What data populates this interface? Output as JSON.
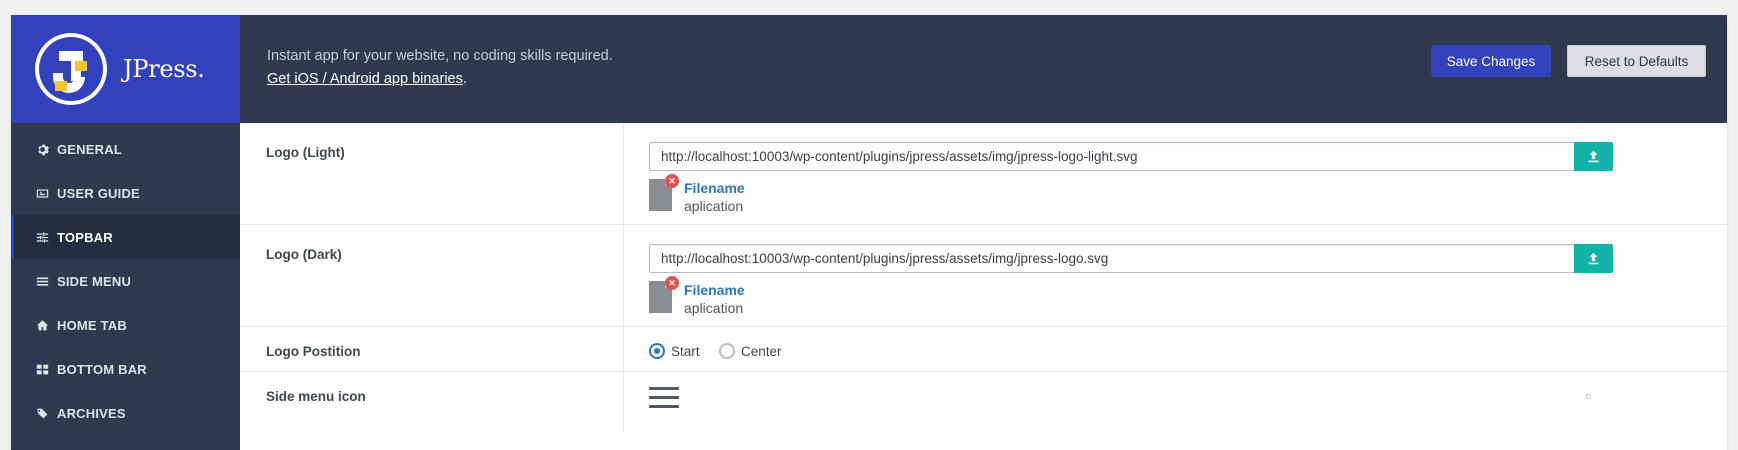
{
  "brand": {
    "name": "JPress."
  },
  "sidebar": {
    "items": [
      {
        "label": "GENERAL",
        "icon": "gear-icon"
      },
      {
        "label": "USER GUIDE",
        "icon": "image-icon"
      },
      {
        "label": "TOPBAR",
        "icon": "sliders-icon",
        "active": true
      },
      {
        "label": "SIDE MENU",
        "icon": "bars-icon"
      },
      {
        "label": "HOME TAB",
        "icon": "home-icon"
      },
      {
        "label": "BOTTOM BAR",
        "icon": "grid-icon"
      },
      {
        "label": "ARCHIVES",
        "icon": "tags-icon"
      }
    ]
  },
  "header": {
    "tagline": "Instant app for your website, no coding skills required.",
    "app_link": "Get iOS / Android app binaries",
    "app_link_suffix": ".",
    "save_label": "Save Changes",
    "reset_label": "Reset to Defaults"
  },
  "settings": {
    "logo_light": {
      "label": "Logo (Light)",
      "url": "http://localhost:10003/wp-content/plugins/jpress/assets/img/jpress-logo-light.svg",
      "file_name": "Filename",
      "file_type": "aplication"
    },
    "logo_dark": {
      "label": "Logo (Dark)",
      "url": "http://localhost:10003/wp-content/plugins/jpress/assets/img/jpress-logo.svg",
      "file_name": "Filename",
      "file_type": "aplication"
    },
    "logo_position": {
      "label": "Logo Postition",
      "options": [
        "Start",
        "Center"
      ],
      "selected": "Start"
    },
    "side_menu_icon": {
      "label": "Side menu icon",
      "icon": "hamburger-menu-icon"
    }
  },
  "colors": {
    "brand_blue": "#3441bd",
    "dark_navy": "#32394f",
    "upload_teal": "#11b2a8",
    "link_blue": "#2f74c3",
    "remove_red": "#e1504f"
  }
}
